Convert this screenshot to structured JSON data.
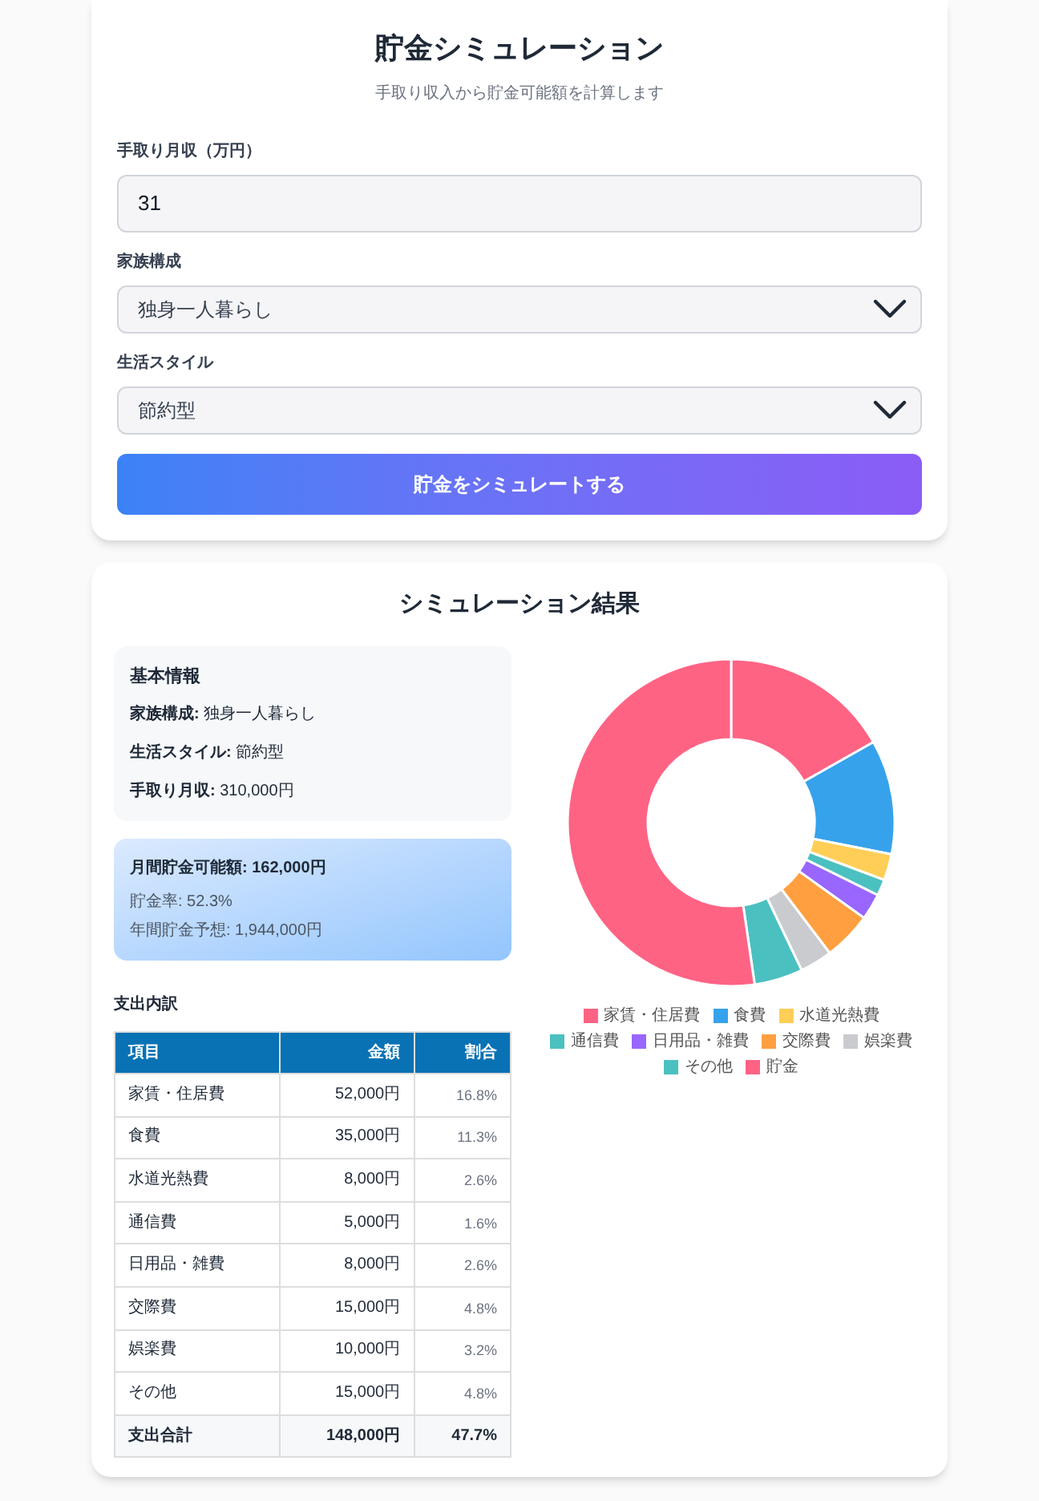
{
  "form": {
    "title": "貯金シミュレーション",
    "subtitle": "手取り収入から貯金可能額を計算します",
    "fields": [
      {
        "kind": "input",
        "label": "手取り月収（万円）",
        "value": "31"
      },
      {
        "kind": "select",
        "label": "家族構成",
        "value": "独身一人暮らし"
      },
      {
        "kind": "select",
        "label": "生活スタイル",
        "value": "節約型"
      }
    ],
    "button": "貯金をシミュレートする"
  },
  "results": {
    "title": "シミュレーション結果",
    "basic_info": {
      "heading": "基本情報",
      "items": [
        {
          "label": "家族構成:",
          "value": "独身一人暮らし"
        },
        {
          "label": "生活スタイル:",
          "value": "節約型"
        },
        {
          "label": "手取り月収:",
          "value": "310,000円"
        }
      ]
    },
    "savings": {
      "headline": "月間貯金可能額: 162,000円",
      "lines": [
        "貯金率: 52.3%",
        "年間貯金予想: 1,944,000円"
      ]
    },
    "breakdown": {
      "heading": "支出内訳",
      "columns": [
        "項目",
        "金額",
        "割合"
      ],
      "rows": [
        {
          "item": "家賃・住居費",
          "amount": "52,000円",
          "share": "16.8%"
        },
        {
          "item": "食費",
          "amount": "35,000円",
          "share": "11.3%"
        },
        {
          "item": "水道光熱費",
          "amount": "8,000円",
          "share": "2.6%"
        },
        {
          "item": "通信費",
          "amount": "5,000円",
          "share": "1.6%"
        },
        {
          "item": "日用品・雑費",
          "amount": "8,000円",
          "share": "2.6%"
        },
        {
          "item": "交際費",
          "amount": "15,000円",
          "share": "4.8%"
        },
        {
          "item": "娯楽費",
          "amount": "10,000円",
          "share": "3.2%"
        },
        {
          "item": "その他",
          "amount": "15,000円",
          "share": "4.8%"
        }
      ],
      "total": {
        "item": "支出合計",
        "amount": "148,000円",
        "share": "47.7%"
      }
    },
    "chart_data": {
      "type": "donut",
      "categories": [
        "家賃・住居費",
        "食費",
        "水道光熱費",
        "通信費",
        "日用品・雑費",
        "交際費",
        "娯楽費",
        "その他",
        "貯金"
      ],
      "colors": [
        "#ff6384",
        "#36a2eb",
        "#ffce56",
        "#4bc0c0",
        "#9966ff",
        "#ff9f40",
        "#c9cbcf",
        "#4bc0c0",
        "#ff6384"
      ],
      "legend": true,
      "series": [
        {
          "values": [
            16.8,
            11.3,
            2.6,
            1.6,
            2.6,
            4.8,
            3.2,
            4.8,
            52.3
          ]
        }
      ]
    }
  }
}
